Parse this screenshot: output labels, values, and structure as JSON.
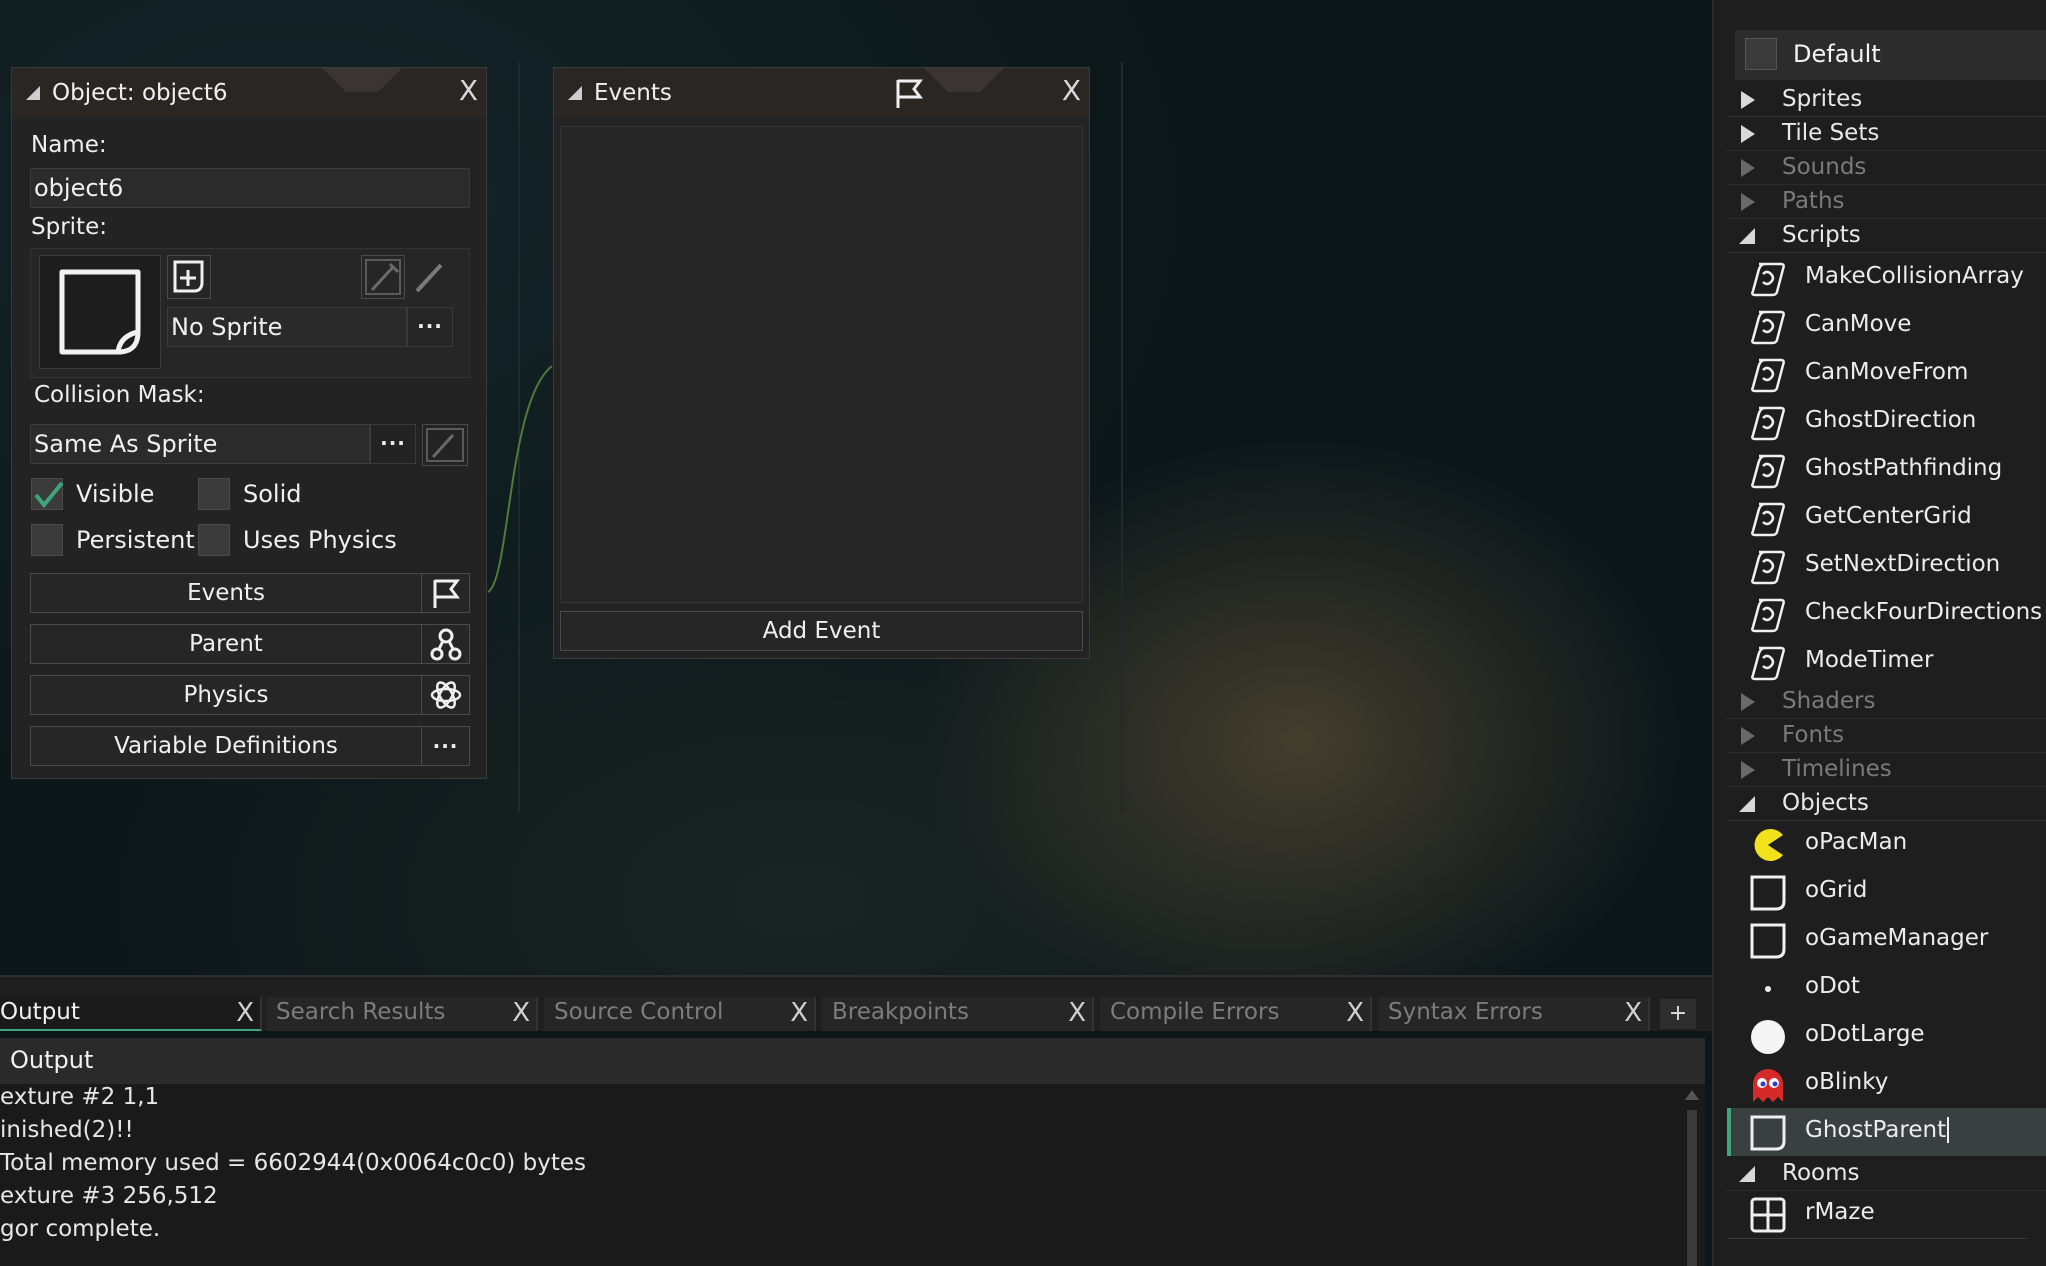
{
  "object_window": {
    "title": "Object: object6",
    "close": "X",
    "name_label": "Name:",
    "name_value": "object6",
    "sprite_label": "Sprite:",
    "sprite_value": "No Sprite",
    "sprite_browse": "···",
    "collision_label": "Collision Mask:",
    "collision_value": "Same As Sprite",
    "collision_browse": "···",
    "checkboxes": {
      "visible": {
        "label": "Visible",
        "checked": true
      },
      "solid": {
        "label": "Solid",
        "checked": false
      },
      "persistent": {
        "label": "Persistent",
        "checked": false
      },
      "uses_physics": {
        "label": "Uses Physics",
        "checked": false
      }
    },
    "buttons": {
      "events": "Events",
      "parent": "Parent",
      "physics": "Physics",
      "variable_definitions": "Variable Definitions",
      "variable_definitions_icon": "···"
    }
  },
  "events_window": {
    "title": "Events",
    "close": "X",
    "add_event": "Add Event"
  },
  "resource_tree": {
    "header": "Default",
    "groups": {
      "sprites": "Sprites",
      "tile_sets": "Tile Sets",
      "sounds": "Sounds",
      "paths": "Paths",
      "scripts": "Scripts",
      "shaders": "Shaders",
      "fonts": "Fonts",
      "timelines": "Timelines",
      "objects": "Objects",
      "rooms": "Rooms"
    },
    "scripts": [
      "MakeCollisionArray",
      "CanMove",
      "CanMoveFrom",
      "GhostDirection",
      "GhostPathfinding",
      "GetCenterGrid",
      "SetNextDirection",
      "CheckFourDirections",
      "ModeTimer"
    ],
    "objects": [
      "oPacMan",
      "oGrid",
      "oGameManager",
      "oDot",
      "oDotLarge",
      "oBlinky",
      "GhostParent"
    ],
    "rooms": [
      "rMaze"
    ]
  },
  "bottom_tabs": {
    "output": "Output",
    "search_results": "Search Results",
    "source_control": "Source Control",
    "breakpoints": "Breakpoints",
    "compile_errors": "Compile Errors",
    "syntax_errors": "Syntax Errors",
    "close": "X",
    "add": "+"
  },
  "output_panel": {
    "header": "Output",
    "lines": [
      "exture #2 1,1",
      "inished(2)!!",
      "Total memory used = 6602944(0x0064c0c0) bytes",
      "exture #3 256,512",
      "gor complete."
    ]
  },
  "colors": {
    "accent_green": "#3fa67a",
    "pacman_yellow": "#f2e21a",
    "blinky_red": "#d42a2a"
  }
}
